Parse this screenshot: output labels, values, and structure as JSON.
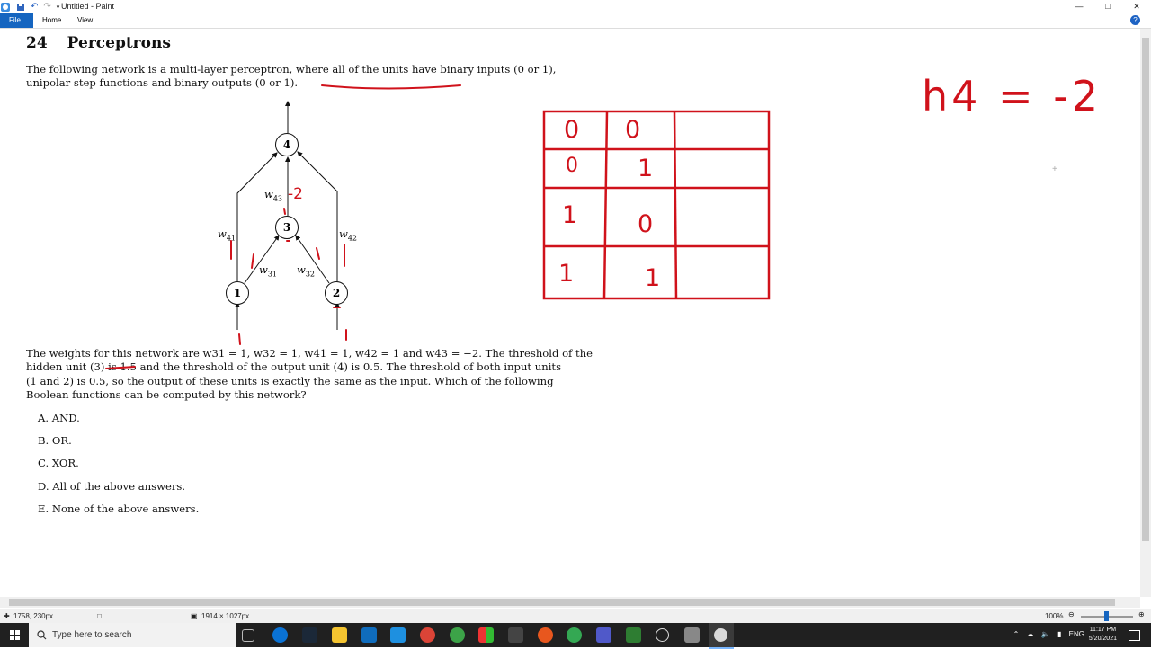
{
  "window": {
    "title": "Untitled - Paint",
    "ribbon_tabs": [
      "File",
      "Home",
      "View"
    ],
    "help": "?"
  },
  "document": {
    "section_number": "24",
    "section_title": "Perceptrons",
    "intro_line1": "The following network is a multi-layer perceptron, where all of the units have binary inputs (0 or 1),",
    "intro_line2": "unipolar step functions and binary outputs (0 or 1).",
    "network": {
      "nodes": [
        "1",
        "2",
        "3",
        "4"
      ],
      "weight_labels": {
        "w41": "41",
        "w42": "42",
        "w43": "43",
        "w31": "31",
        "w32": "32"
      }
    },
    "weights_line1": "The weights for this network are w31 = 1, w32 = 1, w41 = 1, w42 = 1 and w43 = −2. The threshold of the",
    "weights_line2": "hidden unit (3) is 1.5 and the threshold of the output unit (4) is 0.5. The threshold of both input units",
    "weights_line3": "(1 and 2) is 0.5, so the output of these units is exactly the same as the input. Which of the following",
    "weights_line4": "Boolean functions can be computed by this network?",
    "options": [
      {
        "letter": "A.",
        "text": "AND."
      },
      {
        "letter": "B.",
        "text": "OR."
      },
      {
        "letter": "C.",
        "text": "XOR."
      },
      {
        "letter": "D.",
        "text": "All of the above answers."
      },
      {
        "letter": "E.",
        "text": "None of the above answers."
      }
    ]
  },
  "annotations": {
    "ink_color": "#d0121b",
    "w43_handwritten": "-2",
    "formula": "h4 = -2",
    "truth_table": [
      [
        "0",
        "0",
        ""
      ],
      [
        "0",
        "1",
        ""
      ],
      [
        "1",
        "0",
        ""
      ],
      [
        "1",
        "1",
        ""
      ]
    ]
  },
  "statusbar": {
    "cursor_position": "1758, 230px",
    "image_size": "1914 × 1027px",
    "zoom": "100%"
  },
  "taskbar": {
    "search_placeholder": "Type here to search",
    "language": "ENG",
    "time": "11:17 PM",
    "date": "5/20/2021"
  }
}
